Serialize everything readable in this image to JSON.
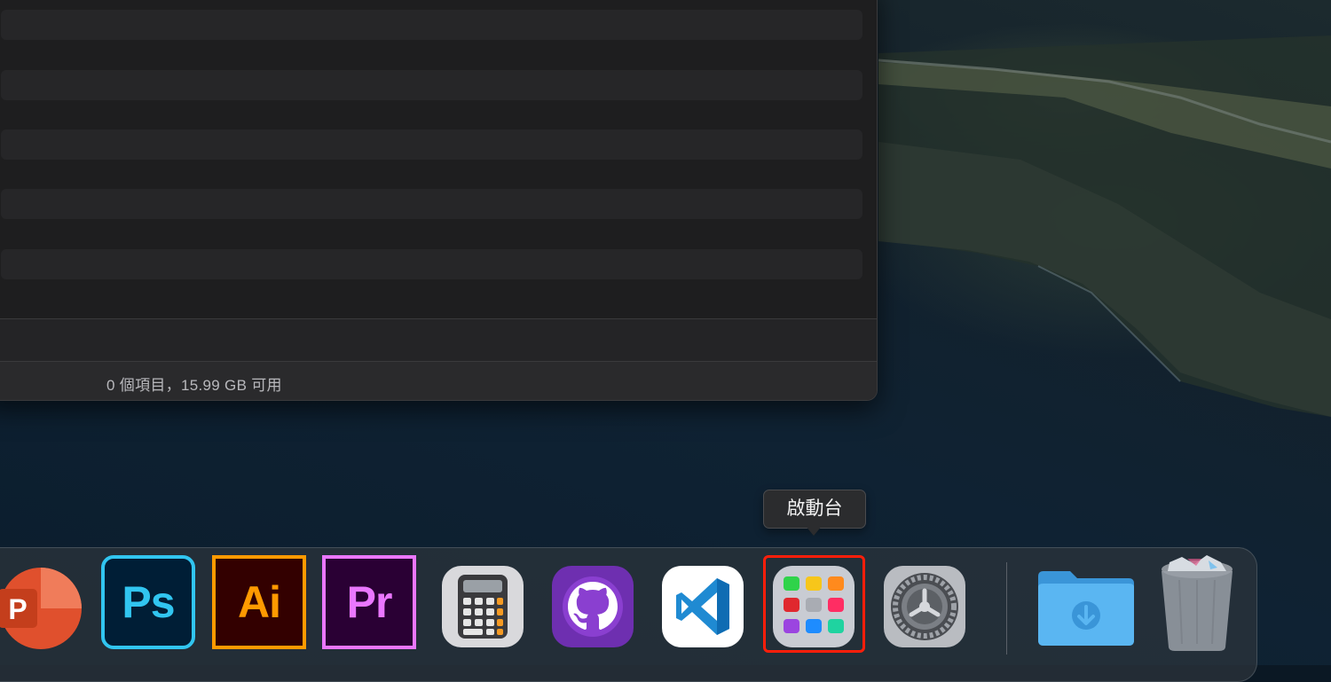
{
  "finder": {
    "status_text": "0 個項目，15.99 GB 可用"
  },
  "tooltip": {
    "label": "啟動台"
  },
  "dock": {
    "items": [
      {
        "name": "powerpoint",
        "glyph": "P",
        "icon": "powerpoint-icon"
      },
      {
        "name": "photoshop",
        "glyph": "Ps",
        "icon": "photoshop-icon",
        "color": "#31c5f0",
        "bg": "#001e36"
      },
      {
        "name": "illustrator",
        "glyph": "Ai",
        "icon": "illustrator-icon",
        "color": "#ff9a00",
        "bg": "#330000"
      },
      {
        "name": "premiere",
        "glyph": "Pr",
        "icon": "premiere-icon",
        "color": "#ea77ff",
        "bg": "#2a0034"
      },
      {
        "name": "calculator",
        "icon": "calculator-icon"
      },
      {
        "name": "github-desktop",
        "icon": "github-icon"
      },
      {
        "name": "visual-studio-code",
        "icon": "vscode-icon"
      },
      {
        "name": "launchpad",
        "icon": "launchpad-icon",
        "highlighted": true
      },
      {
        "name": "system-preferences",
        "icon": "gear-icon"
      },
      {
        "name": "downloads",
        "icon": "downloads-folder-icon"
      },
      {
        "name": "trash",
        "icon": "trash-icon"
      }
    ],
    "highlight_color": "#ff1e0a"
  }
}
